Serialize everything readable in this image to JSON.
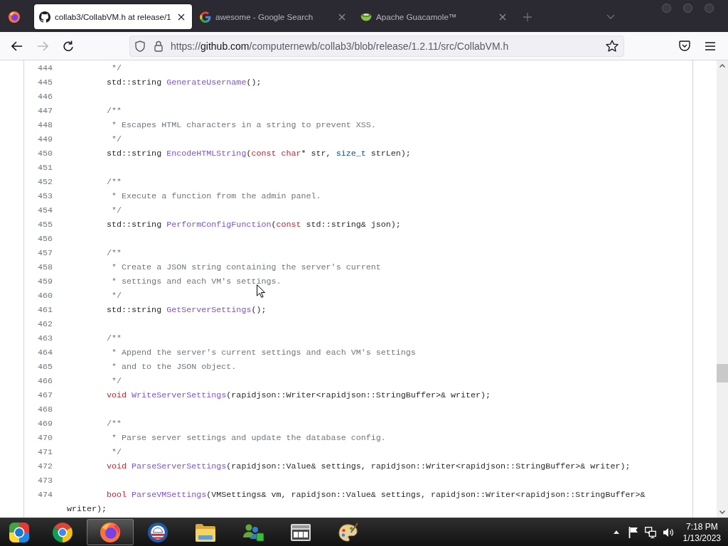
{
  "browser": {
    "tabs": [
      {
        "title": "collab3/CollabVM.h at release/1",
        "selected": true
      },
      {
        "title": "awesome - Google Search",
        "selected": false
      },
      {
        "title": "Apache Guacamole™",
        "selected": false
      }
    ],
    "nav_buttons": [
      {
        "disabled": false
      },
      {
        "disabled": true
      },
      {
        "disabled": false
      }
    ],
    "url": {
      "scheme": "https://",
      "host": "github.com",
      "path": "/computernewb/collab3/blob/release/1.2.11/src/CollabVM.h"
    }
  },
  "code": {
    "lines": [
      {
        "number": "444",
        "tokens": [
          {
            "kind": "comment",
            "text": " */"
          }
        ]
      },
      {
        "number": "445",
        "tokens": [
          {
            "kind": "plain",
            "text": "std::string "
          },
          {
            "kind": "function",
            "text": "GenerateUsername"
          },
          {
            "kind": "plain",
            "text": "();"
          }
        ]
      },
      {
        "number": "446"
      },
      {
        "number": "447",
        "tokens": [
          {
            "kind": "comment",
            "text": "/**"
          }
        ]
      },
      {
        "number": "448",
        "tokens": [
          {
            "kind": "comment",
            "text": " * Escapes HTML characters in a string to prevent XSS."
          }
        ]
      },
      {
        "number": "449",
        "tokens": [
          {
            "kind": "comment",
            "text": " */"
          }
        ]
      },
      {
        "number": "450",
        "tokens": [
          {
            "kind": "plain",
            "text": "std::string "
          },
          {
            "kind": "function",
            "text": "EncodeHTMLString"
          },
          {
            "kind": "plain",
            "text": "("
          },
          {
            "kind": "keyword",
            "text": "const char"
          },
          {
            "kind": "plain",
            "text": "* str, "
          },
          {
            "kind": "type",
            "text": "size_t"
          },
          {
            "kind": "plain",
            "text": " strLen);"
          }
        ]
      },
      {
        "number": "451"
      },
      {
        "number": "452",
        "tokens": [
          {
            "kind": "comment",
            "text": "/**"
          }
        ]
      },
      {
        "number": "453",
        "tokens": [
          {
            "kind": "comment",
            "text": " * Execute a function from the admin panel."
          }
        ]
      },
      {
        "number": "454",
        "tokens": [
          {
            "kind": "comment",
            "text": " */"
          }
        ]
      },
      {
        "number": "455",
        "tokens": [
          {
            "kind": "plain",
            "text": "std::string "
          },
          {
            "kind": "function",
            "text": "PerformConfigFunction"
          },
          {
            "kind": "plain",
            "text": "("
          },
          {
            "kind": "keyword",
            "text": "const"
          },
          {
            "kind": "plain",
            "text": " std::string& json);"
          }
        ]
      },
      {
        "number": "456"
      },
      {
        "number": "457",
        "tokens": [
          {
            "kind": "comment",
            "text": "/**"
          }
        ]
      },
      {
        "number": "458",
        "tokens": [
          {
            "kind": "comment",
            "text": " * Create a JSON string containing the server's current"
          }
        ]
      },
      {
        "number": "459",
        "tokens": [
          {
            "kind": "comment",
            "text": " * settings and each VM's settings."
          }
        ]
      },
      {
        "number": "460",
        "tokens": [
          {
            "kind": "comment",
            "text": " */"
          }
        ]
      },
      {
        "number": "461",
        "tokens": [
          {
            "kind": "plain",
            "text": "std::string "
          },
          {
            "kind": "function",
            "text": "GetServerSettings"
          },
          {
            "kind": "plain",
            "text": "();"
          }
        ]
      },
      {
        "number": "462"
      },
      {
        "number": "463",
        "tokens": [
          {
            "kind": "comment",
            "text": "/**"
          }
        ]
      },
      {
        "number": "464",
        "tokens": [
          {
            "kind": "comment",
            "text": " * Append the server's current settings and each VM's settings"
          }
        ]
      },
      {
        "number": "465",
        "tokens": [
          {
            "kind": "comment",
            "text": " * and to the JSON object."
          }
        ]
      },
      {
        "number": "466",
        "tokens": [
          {
            "kind": "comment",
            "text": " */"
          }
        ]
      },
      {
        "number": "467",
        "tokens": [
          {
            "kind": "keyword",
            "text": "void "
          },
          {
            "kind": "function",
            "text": "WriteServerSettings"
          },
          {
            "kind": "plain",
            "text": "(rapidjson::Writer<rapidjson::StringBuffer>& writer);"
          }
        ]
      },
      {
        "number": "468"
      },
      {
        "number": "469",
        "tokens": [
          {
            "kind": "comment",
            "text": "/**"
          }
        ]
      },
      {
        "number": "470",
        "tokens": [
          {
            "kind": "comment",
            "text": " * Parse server settings and update the database config."
          }
        ]
      },
      {
        "number": "471",
        "tokens": [
          {
            "kind": "comment",
            "text": " */"
          }
        ]
      },
      {
        "number": "472",
        "tokens": [
          {
            "kind": "keyword",
            "text": "void "
          },
          {
            "kind": "function",
            "text": "ParseServerSettings"
          },
          {
            "kind": "plain",
            "text": "(rapidjson::Value& settings, rapidjson::Writer<rapidjson::StringBuffer>& writer);"
          }
        ]
      },
      {
        "number": "473"
      },
      {
        "number": "474",
        "tokens": [
          {
            "kind": "keyword",
            "text": "bool "
          },
          {
            "kind": "function",
            "text": "ParseVMSettings"
          },
          {
            "kind": "plain",
            "text": "(VMSettings& vm, rapidjson::Value& settings, rapidjson::Writer<rapidjson::StringBuffer>& writer);"
          }
        ]
      }
    ]
  },
  "taskbar": {
    "apps": [
      {
        "active": false
      },
      {
        "active": true
      },
      {
        "active": false
      },
      {
        "active": false
      },
      {
        "active": false
      },
      {
        "active": false
      },
      {
        "active": false
      }
    ],
    "clock": {
      "time": "7:18 PM",
      "date": "1/13/2023"
    }
  }
}
